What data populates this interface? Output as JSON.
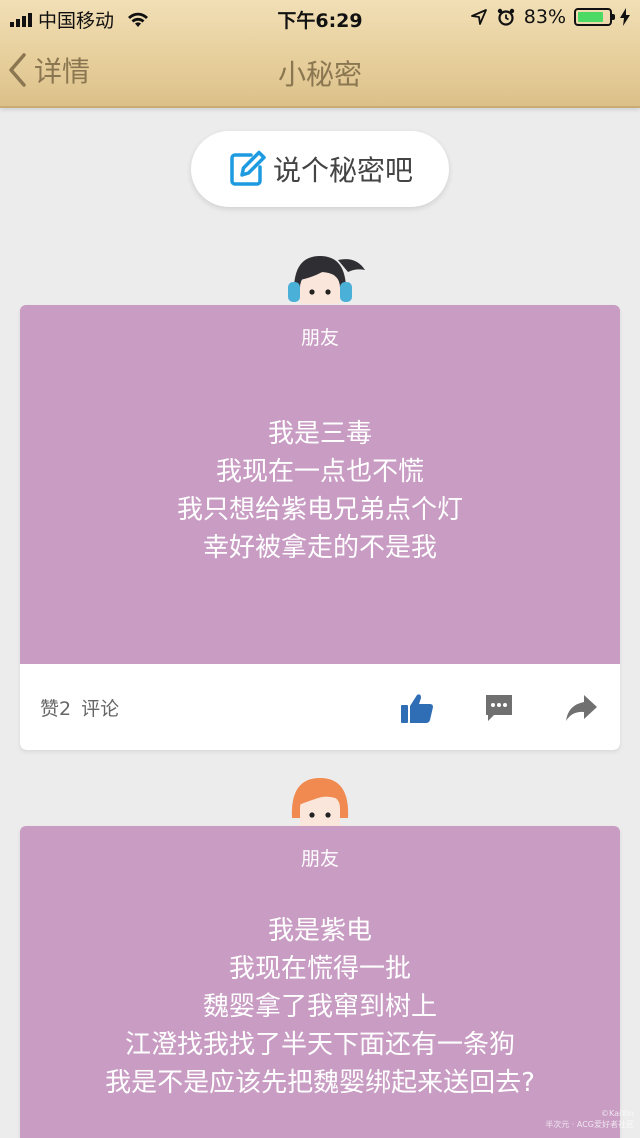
{
  "status_bar": {
    "carrier": "中国移动",
    "time": "下午6:29",
    "battery_percent": "83%",
    "battery_level": 0.83,
    "battery_color": "#4cd964"
  },
  "nav": {
    "back_label": "详情",
    "title": "小秘密"
  },
  "compose": {
    "label": "说个秘密吧",
    "icon": "edit-icon"
  },
  "posts": [
    {
      "relation": "朋友",
      "avatar": "girl-headphones-avatar",
      "lines": [
        "我是三毒",
        "我现在一点也不慌",
        "我只想给紫电兄弟点个灯",
        "幸好被拿走的不是我"
      ],
      "likes_label": "赞2",
      "comments_label": "评论",
      "actions": [
        "like-icon",
        "comment-icon",
        "share-icon"
      ]
    },
    {
      "relation": "朋友",
      "avatar": "girl-orange-hair-avatar",
      "lines": [
        "我是紫电",
        "我现在慌得一批",
        "魏婴拿了我窜到树上",
        "江澄找我找了半天下面还有一条狗",
        "我是不是应该先把魏婴绑起来送回去?"
      ]
    }
  ],
  "watermark": [
    "©KaiXin",
    "半次元 · ACG爱好者社区"
  ],
  "colors": {
    "card": "#c89cc3",
    "nav_text": "#8a7650",
    "like_icon": "#2f6db5"
  }
}
